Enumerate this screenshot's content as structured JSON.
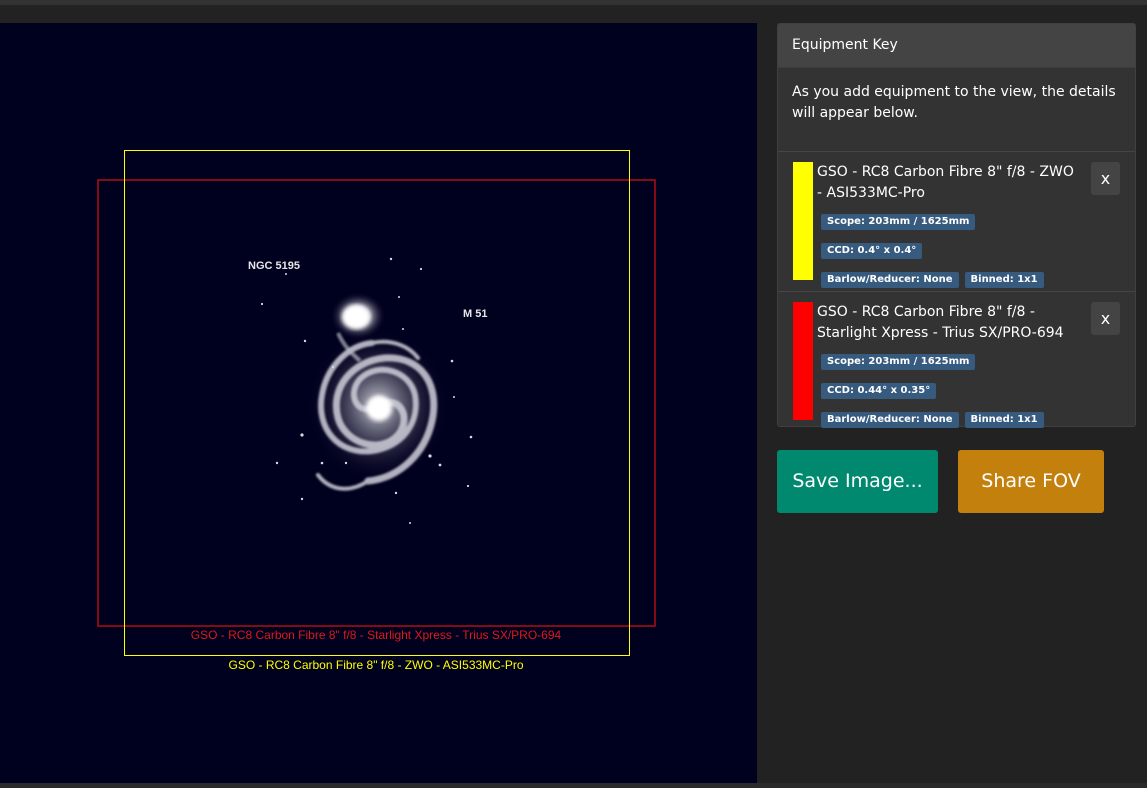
{
  "view": {
    "objects": {
      "ngc5195": "NGC 5195",
      "m51": "M 51"
    },
    "fov_labels": {
      "red": "GSO - RC8 Carbon Fibre 8\" f/8 - Starlight Xpress - Trius SX/PRO-694",
      "yellow": "GSO - RC8 Carbon Fibre 8\" f/8 - ZWO - ASI533MC-Pro"
    },
    "colors": {
      "background": "#00001f",
      "red": "#cc1111",
      "yellow": "#ffff00"
    }
  },
  "equipment_key": {
    "heading": "Equipment Key",
    "intro": "As you add equipment to the view, the details will appear below.",
    "items": [
      {
        "color": "#ffff00",
        "name": "GSO - RC8 Carbon Fibre 8\" f/8 - ZWO - ASI533MC-Pro",
        "scope": "Scope: 203mm / 1625mm",
        "ccd": "CCD: 0.4° x 0.4°",
        "barlow": "Barlow/Reducer: None",
        "binned": "Binned: 1x1",
        "close": "x"
      },
      {
        "color": "#ff0000",
        "name": "GSO - RC8 Carbon Fibre 8\" f/8 - Starlight Xpress - Trius SX/PRO-694",
        "scope": "Scope: 203mm / 1625mm",
        "ccd": "CCD: 0.44° x 0.35°",
        "barlow": "Barlow/Reducer: None",
        "binned": "Binned: 1x1",
        "close": "x"
      }
    ]
  },
  "buttons": {
    "save": "Save Image...",
    "share": "Share FOV"
  },
  "colors": {
    "save": "#00896f",
    "share": "#c4800c",
    "badge": "#375a7f"
  }
}
